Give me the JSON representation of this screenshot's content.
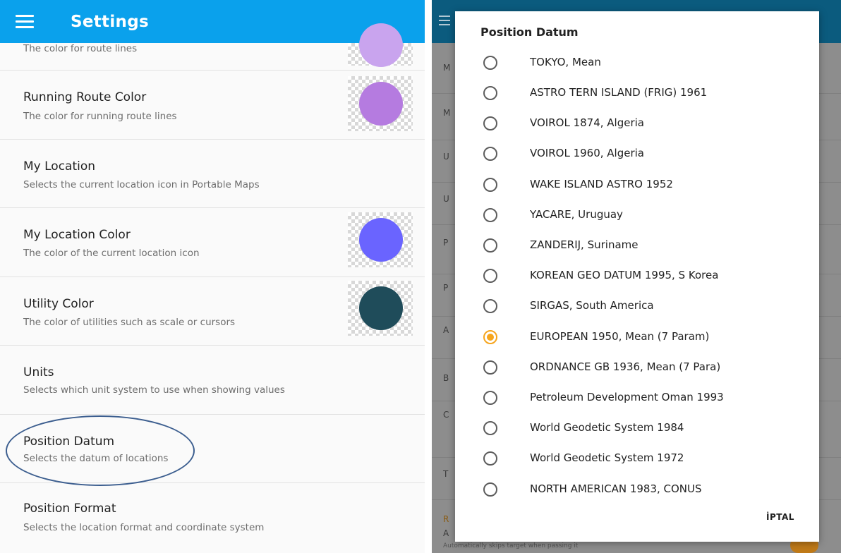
{
  "left": {
    "title": "Settings",
    "partial_item_subtitle": "The color for route lines",
    "items": [
      {
        "title": "Running Route Color",
        "subtitle": "The color for running route lines",
        "swatch": "#b57be0"
      },
      {
        "title": "My Location",
        "subtitle": "Selects the current location icon in Portable Maps"
      },
      {
        "title": "My Location Color",
        "subtitle": "The color of the current location icon",
        "swatch": "#6a64ff"
      },
      {
        "title": "Utility Color",
        "subtitle": "The color of utilities such as scale or cursors",
        "swatch": "#1f4c5a"
      },
      {
        "title": "Units",
        "subtitle": "Selects which unit system to use when showing values"
      },
      {
        "title": "Position Datum",
        "subtitle": "Selects the datum of locations"
      },
      {
        "title": "Position Format",
        "subtitle": "Selects the location format and coordinate system"
      }
    ],
    "partial_swatch_color": "#c9a4ee"
  },
  "right": {
    "dialog_title": "Position Datum",
    "options": [
      {
        "label": "TOKYO, Mean",
        "selected": false
      },
      {
        "label": "ASTRO TERN ISLAND (FRIG) 1961",
        "selected": false
      },
      {
        "label": "VOIROL 1874, Algeria",
        "selected": false
      },
      {
        "label": "VOIROL 1960, Algeria",
        "selected": false
      },
      {
        "label": "WAKE ISLAND ASTRO 1952",
        "selected": false
      },
      {
        "label": "YACARE, Uruguay",
        "selected": false
      },
      {
        "label": "ZANDERIJ, Suriname",
        "selected": false
      },
      {
        "label": "KOREAN GEO DATUM 1995, S Korea",
        "selected": false
      },
      {
        "label": "SIRGAS, South America",
        "selected": false
      },
      {
        "label": "EUROPEAN 1950, Mean (7 Param)",
        "selected": true
      },
      {
        "label": "ORDNANCE GB 1936, Mean (7 Para)",
        "selected": false
      },
      {
        "label": "Petroleum Development Oman 1993",
        "selected": false
      },
      {
        "label": "World Geodetic System 1984",
        "selected": false
      },
      {
        "label": "World Geodetic System 1972",
        "selected": false
      },
      {
        "label": "NORTH AMERICAN 1983, CONUS",
        "selected": false
      }
    ],
    "cancel_label": "İPTAL",
    "background_letters": [
      "M",
      "M",
      "U",
      "U",
      "P",
      "P",
      "A",
      "B",
      "C",
      "T",
      "R",
      "A"
    ],
    "background_subtext": "Automatically skips target when passing it",
    "accent_color": "#f6a51d"
  }
}
